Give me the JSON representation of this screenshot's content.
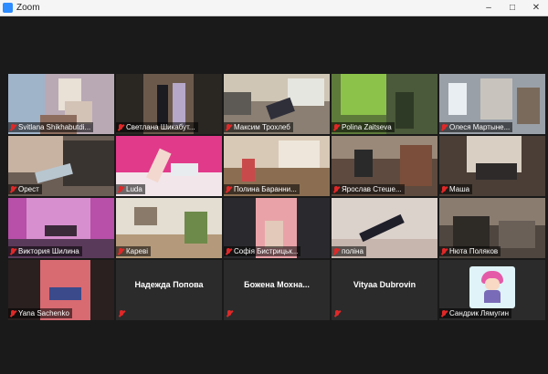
{
  "window": {
    "title": "Zoom",
    "controls": [
      "–",
      "□",
      "✕"
    ]
  },
  "colors": {
    "active_speaker": "#c8d43a",
    "muted_mic": "#e02828",
    "tile_bg": "#2b2b2b"
  },
  "participants": [
    {
      "name": "Svitlana Shikhabutdi...",
      "video": true,
      "muted": true,
      "active": true
    },
    {
      "name": "Светлана Шикабут...",
      "video": true,
      "muted": true
    },
    {
      "name": "Максим Трохлеб",
      "video": true,
      "muted": true
    },
    {
      "name": "Polina Zaitseva",
      "video": true,
      "muted": true
    },
    {
      "name": "Олеся Мартыне...",
      "video": true,
      "muted": true
    },
    {
      "name": "Орест",
      "video": true,
      "muted": true
    },
    {
      "name": "Luda",
      "video": true,
      "muted": true
    },
    {
      "name": "Полина Баранни...",
      "video": true,
      "muted": true
    },
    {
      "name": "Ярослав Стеше...",
      "video": true,
      "muted": true
    },
    {
      "name": "Маша",
      "video": true,
      "muted": true
    },
    {
      "name": "Виктория Шилина",
      "video": true,
      "muted": true
    },
    {
      "name": "Кареві",
      "video": true,
      "muted": true
    },
    {
      "name": "Софія Бистрицьк...",
      "video": true,
      "muted": true
    },
    {
      "name": "поліна",
      "video": true,
      "muted": true
    },
    {
      "name": "Нюта Поляков",
      "video": true,
      "muted": true
    },
    {
      "name": "Yana Sachenko",
      "video": true,
      "muted": true
    },
    {
      "name": "Надежда Попова",
      "video": false,
      "muted": true
    },
    {
      "name": "Божена Мохна...",
      "video": false,
      "muted": true
    },
    {
      "name": "Vityaa Dubrovin",
      "video": false,
      "muted": true
    },
    {
      "name": "Сандрик Лямугин",
      "video": false,
      "avatar": true,
      "muted": true
    }
  ]
}
